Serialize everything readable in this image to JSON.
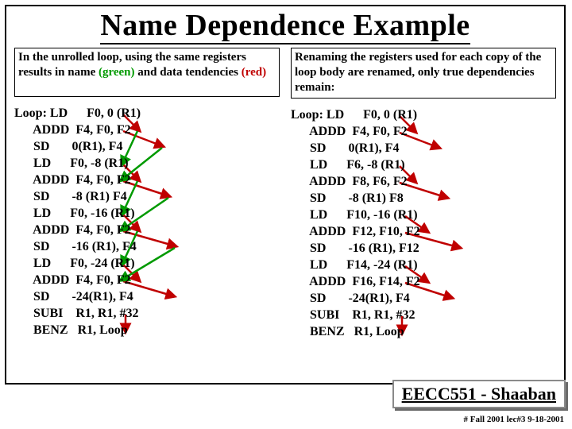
{
  "title": "Name Dependence Example",
  "left": {
    "intro_pre": "In the unrolled loop, using the same registers results in name ",
    "intro_green": "(green)",
    "intro_mid": " and data tendencies ",
    "intro_red": "(red)",
    "loop_label": "Loop: ",
    "lines": [
      {
        "op": "LD",
        "args": "F0, 0 (R1)"
      },
      {
        "op": "ADDD",
        "args": "F4, F0, F2"
      },
      {
        "op": "SD",
        "args": "0(R1), F4"
      },
      {
        "op": "LD",
        "args": "F0, -8 (R1)"
      },
      {
        "op": "ADDD",
        "args": "F4, F0, F2"
      },
      {
        "op": "SD",
        "args": "-8 (R1) F4"
      },
      {
        "op": "LD",
        "args": "F0, -16 (R1)"
      },
      {
        "op": "ADDD",
        "args": "F4, F0, F2"
      },
      {
        "op": "SD",
        "args": "-16 (R1), F4"
      },
      {
        "op": "LD",
        "args": "F0, -24 (R1)"
      },
      {
        "op": "ADDD",
        "args": "F4, F0, F2"
      },
      {
        "op": "SD",
        "args": "-24(R1), F4"
      },
      {
        "op": "SUBI",
        "args": "R1, R1, #32"
      },
      {
        "op": "BENZ",
        "args": "R1, Loop"
      }
    ]
  },
  "right": {
    "intro": "Renaming the registers used for each copy of the loop body are renamed, only true dependencies remain:",
    "loop_label": "Loop: ",
    "lines": [
      {
        "op": "LD",
        "args": "F0, 0 (R1)"
      },
      {
        "op": "ADDD",
        "args": "F4, F0, F2"
      },
      {
        "op": "SD",
        "args": "0(R1), F4"
      },
      {
        "op": "LD",
        "args": "F6, -8 (R1)"
      },
      {
        "op": "ADDD",
        "args": "F8, F6, F2"
      },
      {
        "op": "SD",
        "args": "-8 (R1) F8"
      },
      {
        "op": "LD",
        "args": "F10, -16 (R1)"
      },
      {
        "op": "ADDD",
        "args": "F12, F10, F2"
      },
      {
        "op": "SD",
        "args": "-16 (R1), F12"
      },
      {
        "op": "LD",
        "args": "F14, -24 (R1)"
      },
      {
        "op": "ADDD",
        "args": "F16, F14, F2"
      },
      {
        "op": "SD",
        "args": "-24(R1), F4"
      },
      {
        "op": "SUBI",
        "args": "R1, R1, #32"
      },
      {
        "op": "BENZ",
        "args": "R1, Loop"
      }
    ]
  },
  "footer": "EECC551 - Shaaban",
  "tiny_footer": "#  Fall 2001  lec#3   9-18-2001",
  "colors": {
    "red": "#c00000",
    "green": "#009a00"
  }
}
